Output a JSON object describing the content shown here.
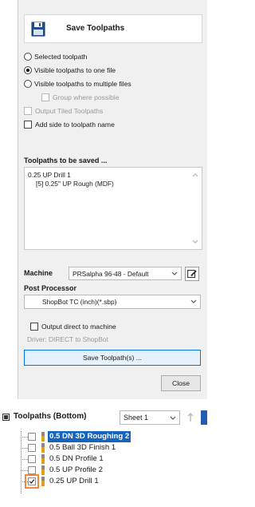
{
  "dialog": {
    "title": "Save Toolpaths",
    "output_mode": {
      "selected": "Selected toolpath",
      "one_file": "Visible toolpaths to one file",
      "multiple_files": "Visible toolpaths to multiple files",
      "active": "one_file"
    },
    "group_where_possible": {
      "label": "Group where possible",
      "checked": false,
      "enabled": false
    },
    "output_tiled": {
      "label": "Output Tiled Toolpaths",
      "checked": false,
      "enabled": false
    },
    "add_side": {
      "label": "Add side to toolpath name",
      "checked": false
    },
    "toolpaths_section": {
      "title": "Toolpaths to be saved ...",
      "items": [
        "0.25 UP Drill 1",
        "[5] 0.25\" UP Rough (MDF)"
      ]
    },
    "machine": {
      "label": "Machine",
      "value": "PRSalpha 96-48 - Default"
    },
    "post_processor": {
      "label": "Post Processor",
      "value": "ShopBot TC (inch)(*.sbp)"
    },
    "output_direct": {
      "label": "Output direct to machine",
      "checked": false
    },
    "driver_text": "Driver: DIRECT to ShopBot",
    "save_button": "Save Toolpath(s) ...",
    "close_button": "Close"
  },
  "toolpaths_panel": {
    "title": "Toolpaths (Bottom)",
    "sheet": "Sheet 1",
    "items": [
      {
        "label": "0.5 DN 3D Roughing 2",
        "checked": false,
        "selected": true
      },
      {
        "label": "0.5 Ball 3D Finish 1",
        "checked": false,
        "selected": false
      },
      {
        "label": "0.5 DN Profile 1",
        "checked": false,
        "selected": false
      },
      {
        "label": "0.5 UP Profile 2",
        "checked": false,
        "selected": false
      },
      {
        "label": "0.25 UP Drill 1",
        "checked": true,
        "selected": false
      }
    ]
  },
  "colors": {
    "selection": "#1565c0",
    "highlight_box": "#f0883a",
    "primary_button_border": "#0078d7"
  }
}
